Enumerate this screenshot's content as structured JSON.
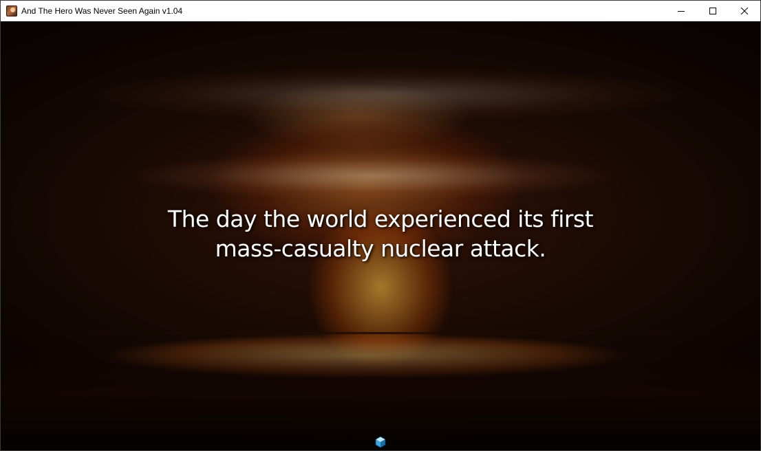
{
  "window": {
    "title": "And The Hero Was Never Seen Again v1.04",
    "app_icon": "game-portrait-icon",
    "controls": [
      "minimize-icon",
      "maximize-icon",
      "close-icon"
    ]
  },
  "scene": {
    "background": "nuclear-mushroom-cloud",
    "caption": {
      "line1": "The day the world experienced its first",
      "line2": "mass-casualty nuclear attack."
    },
    "indicator_icon": "blue-cube-icon"
  },
  "colors": {
    "caption_text": "#ffffff",
    "titlebar_bg": "#ffffff",
    "cube_accent": "#3aa7e0"
  }
}
